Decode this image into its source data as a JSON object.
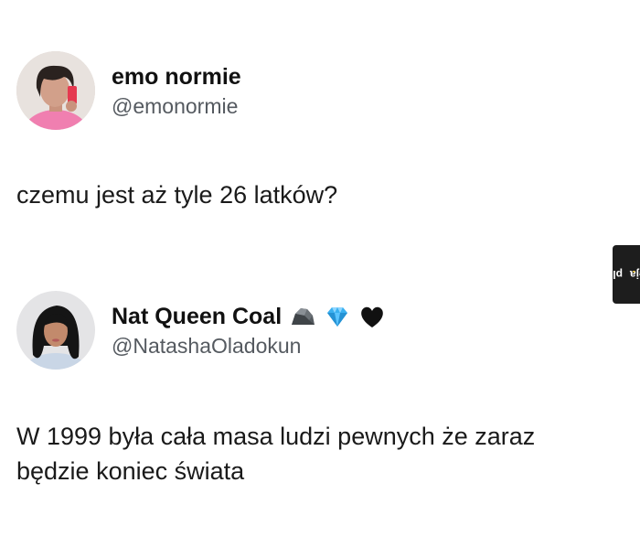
{
  "tweets": [
    {
      "display_name": "emo normie",
      "handle": "@emonormie",
      "text": "czemu jest aż tyle 26 latków?",
      "name_emojis": []
    },
    {
      "display_name": "Nat Queen Coal",
      "handle": "@NatashaOladokun",
      "text": "W 1999 była cała masa ludzi pewnych że zaraz będzie koniec świata",
      "name_emojis": [
        "rock-icon",
        "gem-icon",
        "black-heart-icon"
      ]
    }
  ],
  "watermark": {
    "text": "jeja",
    "suffix": "pl"
  },
  "colors": {
    "text": "#111111",
    "handle": "#555a60",
    "gem": "#3ab0f0",
    "watermark_bg": "#1d1d1d",
    "watermark_dot": "#f2c31b"
  }
}
